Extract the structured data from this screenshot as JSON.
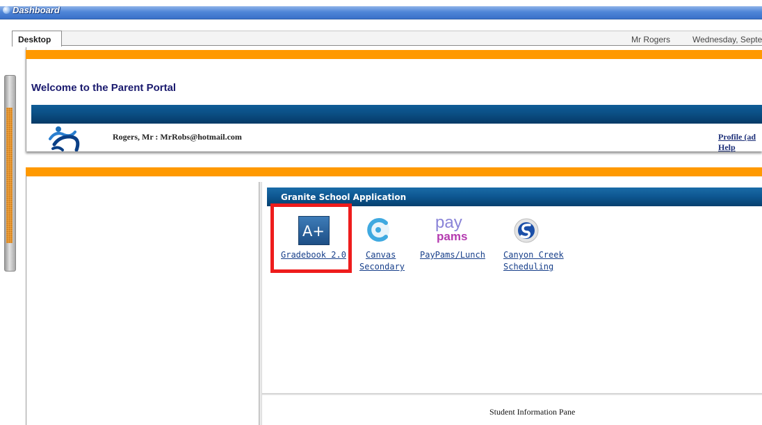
{
  "window": {
    "title": "Dashboard"
  },
  "tabs": [
    {
      "label": "Desktop"
    }
  ],
  "header": {
    "user": "Mr Rogers",
    "date": "Wednesday, Septe"
  },
  "welcome": {
    "heading": "Welcome to the Parent Portal",
    "account": "Rogers, Mr : MrRobs@hotmail.com",
    "links": {
      "profile": "Profile (ad",
      "help": "Help"
    }
  },
  "apps_panel": {
    "title": "Granite School Application",
    "apps": [
      {
        "label_lines": [
          "Gradebook 2.0"
        ],
        "icon": "gradebook-a-plus-icon",
        "icon_text": "A+",
        "highlighted": true
      },
      {
        "label_lines": [
          "Canvas",
          "Secondary"
        ],
        "icon": "canvas-icon"
      },
      {
        "label_lines": [
          "PayPams/Lunch"
        ],
        "icon": "paypams-icon",
        "icon_text": [
          "pay",
          "pams"
        ]
      },
      {
        "label_lines": [
          "Canyon Creek",
          "Scheduling"
        ],
        "icon": "canyon-creek-icon"
      }
    ]
  },
  "student_pane": {
    "label": "Student Information Pane"
  },
  "colors": {
    "orange_rule": "#ff9900",
    "band_blue": "#0b4f85",
    "heading_navy": "#1a1a6e",
    "link_blue": "#173f8a",
    "highlight_red": "#ee1c1c"
  }
}
